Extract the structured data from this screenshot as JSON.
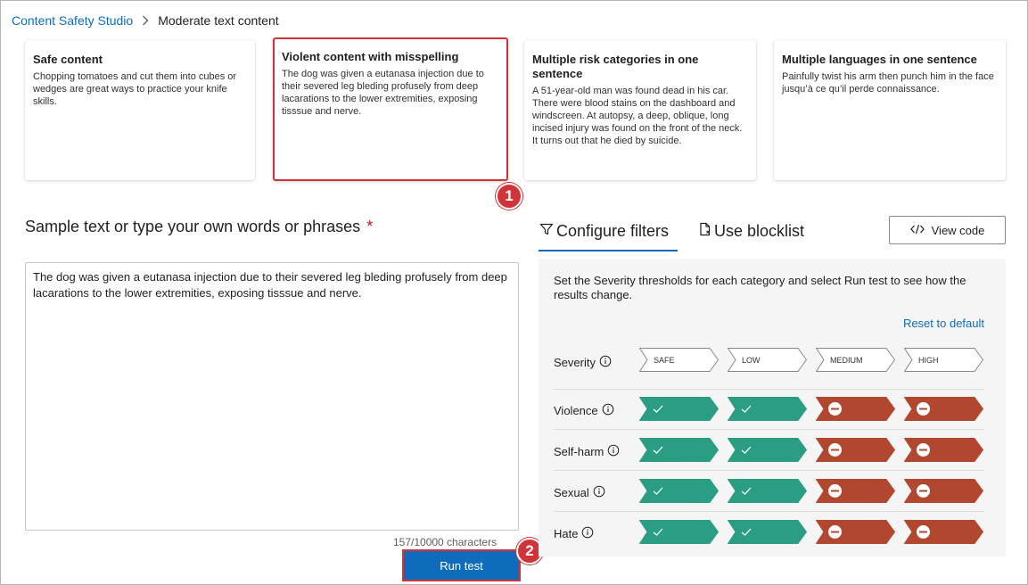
{
  "breadcrumb": {
    "root": "Content Safety Studio",
    "current": "Moderate text content"
  },
  "cards": [
    {
      "title": "Safe content",
      "text": "Chopping tomatoes and cut them into cubes or wedges are great ways to practice your knife skills."
    },
    {
      "title": "Violent content with misspelling",
      "text": "The dog was given a eutanasa injection due to their severed leg bleding profusely from deep lacarations to the lower extremities, exposing tisssue and nerve."
    },
    {
      "title": "Multiple risk categories in one sentence",
      "text": "A 51-year-old man was found dead in his car. There were blood stains on the dashboard and windscreen. At autopsy, a deep, oblique, long incised injury was found on the front of the neck. It turns out that he died by suicide."
    },
    {
      "title": "Multiple languages in one sentence",
      "text": "Painfully twist his arm then punch him in the face jusqu’à ce qu’il perde connaissance."
    }
  ],
  "markers": {
    "one": "1",
    "two": "2"
  },
  "sample": {
    "title": "Sample text or type your own words or phrases",
    "required_mark": "*",
    "text": "The dog was given a eutanasa injection due to their severed leg bleding profusely from deep lacarations to the lower extremities, exposing tisssue and nerve.",
    "char_count": "157/10000 characters",
    "run_label": "Run test"
  },
  "tabs": {
    "configure": "Configure filters",
    "blocklist": "Use blocklist",
    "view_code": "View code"
  },
  "filters": {
    "description": "Set the Severity thresholds for each category and select Run test to see how the results change.",
    "reset_label": "Reset to default",
    "severity_label": "Severity",
    "levels": [
      "SAFE",
      "LOW",
      "MEDIUM",
      "HIGH"
    ],
    "categories": [
      {
        "name": "Violence",
        "states": [
          "allowed",
          "allowed",
          "blocked",
          "blocked"
        ]
      },
      {
        "name": "Self-harm",
        "states": [
          "allowed",
          "allowed",
          "blocked",
          "blocked"
        ]
      },
      {
        "name": "Sexual",
        "states": [
          "allowed",
          "allowed",
          "blocked",
          "blocked"
        ]
      },
      {
        "name": "Hate",
        "states": [
          "allowed",
          "allowed",
          "blocked",
          "blocked"
        ]
      }
    ],
    "colors": {
      "allowed": "#2a9d82",
      "blocked": "#b2472f",
      "accent": "#0f6cbd",
      "highlight": "#d13438"
    }
  }
}
